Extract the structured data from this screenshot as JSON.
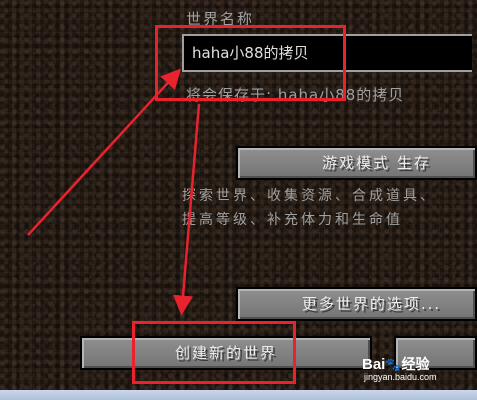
{
  "world_name": {
    "label": "世界名称",
    "value": "haha小88的拷贝",
    "save_hint": "将会保存于: haha小88的拷贝"
  },
  "game_mode_button": {
    "label": "游戏模式 生存"
  },
  "game_mode_description": [
    "探索世界、收集资源、合成道具、",
    "提高等级、补充体力和生命值"
  ],
  "more_options_button": {
    "label": "更多世界的选项..."
  },
  "create_world_button": {
    "label": "创建新的世界"
  },
  "cancel_button": {
    "label": ""
  },
  "annotation": {
    "color": "#e8232e"
  },
  "watermark": {
    "brand_left": "Bai",
    "paw": "🐾",
    "brand_right": "经验",
    "url": "jingyan.baidu.com"
  }
}
